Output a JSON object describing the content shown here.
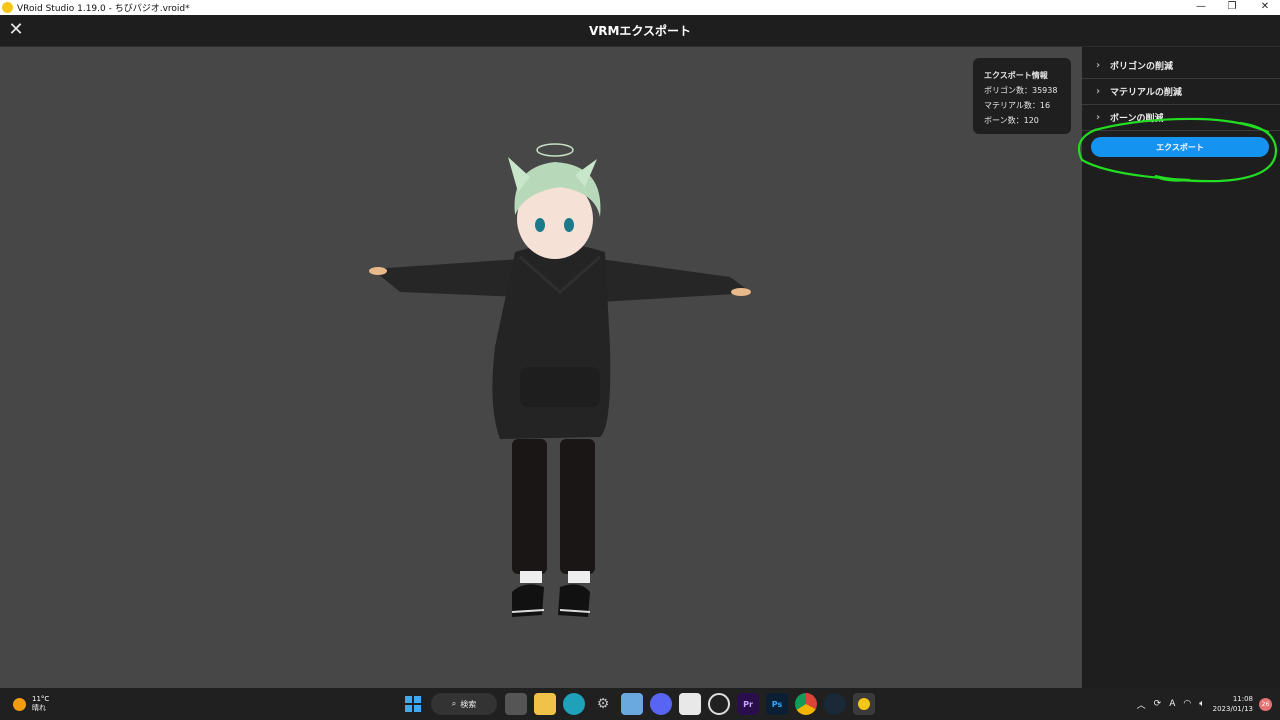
{
  "window": {
    "title": "VRoid Studio 1.19.0 - ちびパジオ.vroid*",
    "minimize": "—",
    "maximize": "❐",
    "close": "✕"
  },
  "header": {
    "close_icon": "✕",
    "title": "VRMエクスポート"
  },
  "export_info": {
    "heading": "エクスポート情報",
    "polygons": "ポリゴン数：35938",
    "materials": "マテリアル数：16",
    "bones": "ボーン数：120"
  },
  "sidebar": {
    "sections": [
      {
        "label": "ポリゴンの削減"
      },
      {
        "label": "マテリアルの削減"
      },
      {
        "label": "ボーンの削減"
      }
    ],
    "export_button": "エクスポート"
  },
  "colors": {
    "accent": "#1593f1",
    "highlight_annotation": "#22dd22",
    "panel": "#1e1e1e",
    "viewport": "#474747"
  },
  "taskbar": {
    "weather_temp": "11°C",
    "weather_desc": "晴れ",
    "search_label": "検索",
    "pinned": [
      "start-icon",
      "search",
      "task-view-icon",
      "file-explorer-icon",
      "edge-icon",
      "settings-icon",
      "photos-icon",
      "discord-icon",
      "store-icon",
      "obs-icon",
      "premiere-icon",
      "photoshop-icon",
      "chrome-icon",
      "steam-icon",
      "vroid-icon"
    ],
    "premiere_label": "Pr",
    "photoshop_label": "Ps",
    "ime": "A",
    "time": "11:08",
    "date": "2023/01/13",
    "notifications": "26"
  }
}
